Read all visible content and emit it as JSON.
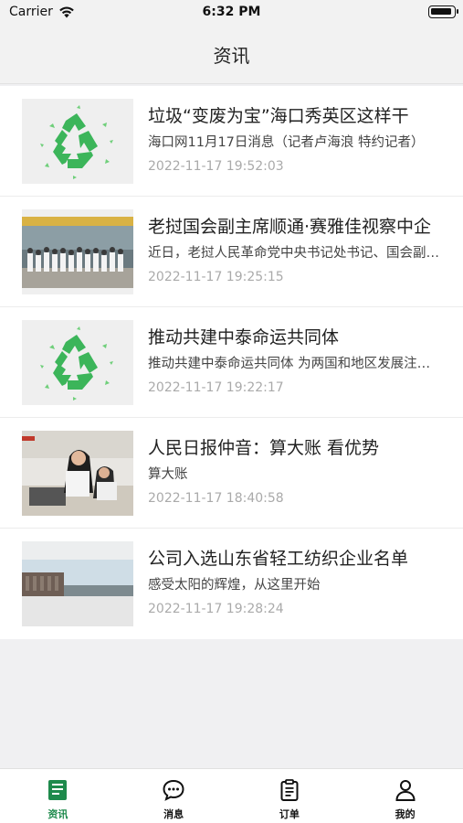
{
  "status_bar": {
    "carrier": "Carrier",
    "time": "6:32 PM"
  },
  "nav": {
    "title": "资讯"
  },
  "news": [
    {
      "title": "垃圾“变废为宝”海口秀英区这样干",
      "summary": "海口网11月17日消息（记者卢海浪 特约记者）",
      "time": "2022-11-17 19:52:03",
      "image": "recycle"
    },
    {
      "title": "老挝国会副主席顺通·赛雅佳视察中企",
      "summary": "近日，老挝人民革命党中央书记处书记、国会副主席",
      "time": "2022-11-17 19:25:15",
      "image": "group-photo"
    },
    {
      "title": "推动共建中泰命运共同体",
      "summary": "推动共建中泰命运共同体 为两国和地区发展注入新动力",
      "time": "2022-11-17 19:22:17",
      "image": "recycle"
    },
    {
      "title": "人民日报仲音：算大账 看优势",
      "summary": "算大账",
      "time": "2022-11-17 18:40:58",
      "image": "office"
    },
    {
      "title": "公司入选山东省轻工纺织企业名单",
      "summary": "感受太阳的辉煌，从这里开始",
      "time": "2022-11-17 19:28:24",
      "image": "building"
    }
  ],
  "tabs": [
    {
      "label": "资讯",
      "icon": "news-book-icon",
      "active": true
    },
    {
      "label": "消息",
      "icon": "chat-bubble-icon",
      "active": false
    },
    {
      "label": "订单",
      "icon": "order-clipboard-icon",
      "active": false
    },
    {
      "label": "我的",
      "icon": "person-icon",
      "active": false
    }
  ],
  "colors": {
    "accent": "#1e8a4c",
    "recycle_green": "#3cb55a"
  }
}
